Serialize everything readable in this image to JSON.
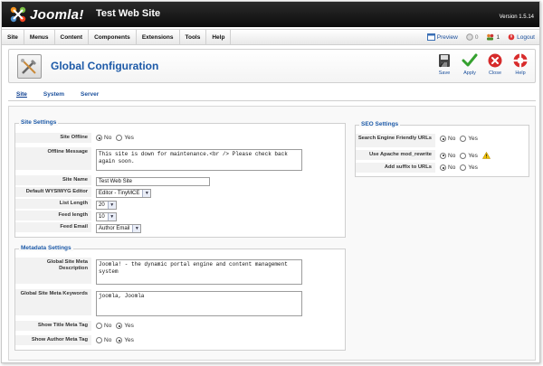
{
  "header": {
    "brand": "Joomla!",
    "site_title": "Test Web Site",
    "version": "Version 1.5.14"
  },
  "menu": {
    "items": [
      "Site",
      "Menus",
      "Content",
      "Components",
      "Extensions",
      "Tools",
      "Help"
    ]
  },
  "status": {
    "preview": "Preview",
    "messages": "0",
    "users": "1",
    "logout": "Logout"
  },
  "toolbar": {
    "title": "Global Configuration",
    "save": "Save",
    "apply": "Apply",
    "close": "Close",
    "help": "Help"
  },
  "tabs": [
    "Site",
    "System",
    "Server"
  ],
  "site_settings": {
    "legend": "Site Settings",
    "offline_label": "Site Offline",
    "offline_value": "No",
    "no": "No",
    "yes": "Yes",
    "offline_message_label": "Offline Message",
    "offline_message": "This site is down for maintenance.<br /> Please check back again soon.",
    "site_name_label": "Site Name",
    "site_name": "Test Web Site",
    "editor_label": "Default WYSIWYG Editor",
    "editor": "Editor - TinyMCE",
    "list_length_label": "List Length",
    "list_length": "20",
    "feed_length_label": "Feed length",
    "feed_length": "10",
    "feed_email_label": "Feed Email",
    "feed_email": "Author Email"
  },
  "metadata_settings": {
    "legend": "Metadata Settings",
    "description_label": "Global Site Meta Description",
    "description": "Joomla! - the dynamic portal engine and content management system",
    "keywords_label": "Global Site Meta Keywords",
    "keywords": "joomla, Joomla",
    "show_title_label": "Show Title Meta Tag",
    "show_title": "Yes",
    "show_author_label": "Show Author Meta Tag",
    "show_author": "Yes"
  },
  "seo_settings": {
    "legend": "SEO Settings",
    "sef_label": "Search Engine Friendly URLs",
    "sef": "No",
    "rewrite_label": "Use Apache mod_rewrite",
    "rewrite": "No",
    "suffix_label": "Add suffix to URLs",
    "suffix": "No"
  },
  "colors": {
    "accent": "#1d5aa8",
    "header_bg": "#1a1a1a"
  }
}
